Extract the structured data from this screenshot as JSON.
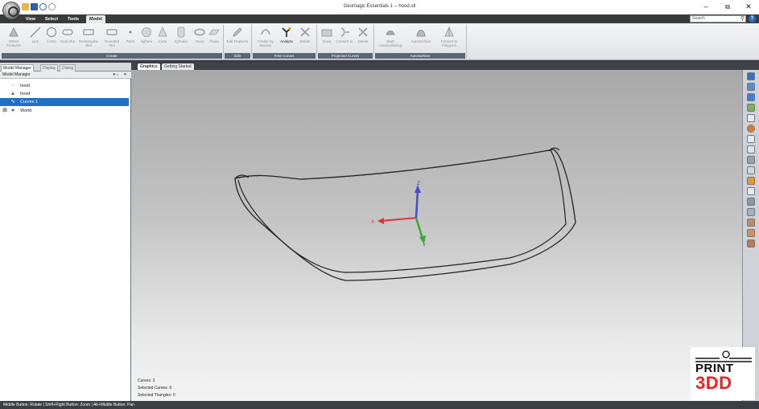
{
  "window": {
    "title": "Geomagic Essentials 1 -- hood.stl",
    "minimize_icon": "–",
    "restore_icon": "⧉",
    "close_icon": "✕"
  },
  "ribbon": {
    "tabs": [
      {
        "id": "view",
        "label": "View"
      },
      {
        "id": "select",
        "label": "Select"
      },
      {
        "id": "tools",
        "label": "Tools"
      },
      {
        "id": "model",
        "label": "Model",
        "active": true
      }
    ],
    "search_placeholder": "Search",
    "help_label": "?",
    "groups": [
      {
        "label": "Create"
      },
      {
        "label": "Edit"
      },
      {
        "label": "Free Curves"
      },
      {
        "label": "Projected Curves"
      },
      {
        "label": "AutoSurface"
      }
    ],
    "buttons": {
      "detect_features": "Detect Features",
      "line": "Line",
      "circle": "Circle",
      "oval_slot": "Oval Slot",
      "rectangular_slot": "Rectangular Slot",
      "rounded_slot": "Rounded Slot",
      "point": "Point",
      "sphere": "Sphere",
      "cone": "Cone",
      "cylinder": "Cylinder",
      "torus": "Torus",
      "plane": "Plane",
      "edit_features": "Edit Features",
      "create_by_section": "Create by Section",
      "analyze": "Analyze",
      "delete_free": "Delete",
      "draw": "Draw",
      "convert_to": "Convert to",
      "delete_projected": "Delete",
      "start_autosurfacing": "Start AutoSurfacing",
      "autosurface": "AutoSurface",
      "convert_to_polygons": "Convert to Polygons"
    }
  },
  "left_panel": {
    "tabs": [
      {
        "id": "model-manager",
        "label": "Model Manager",
        "active": true
      },
      {
        "id": "display",
        "label": "Display"
      },
      {
        "id": "dialog",
        "label": "Dialog"
      }
    ],
    "header": {
      "title": "Model Manager",
      "pin": "▾ ⌂",
      "close": "✕"
    },
    "tree": [
      {
        "label": "hood",
        "icon": "point-cloud-icon",
        "glyph": "⁘"
      },
      {
        "label": "hood",
        "icon": "mesh-icon",
        "glyph": "▲"
      },
      {
        "label": "Curves 1",
        "icon": "curves-icon",
        "glyph": "∿",
        "selected": true
      },
      {
        "label": "World",
        "icon": "globe-icon",
        "glyph": "●",
        "expander": "⊞"
      }
    ]
  },
  "viewport": {
    "doc_tabs": [
      {
        "label": "Graphics",
        "active": true
      },
      {
        "label": "Getting Started"
      }
    ],
    "axes": {
      "x": "X",
      "y": "Y",
      "z": "Z"
    },
    "stats": [
      "Curves: 3",
      "Selected Curves: 0",
      "Selected Triangles: 0"
    ]
  },
  "statusbar": {
    "text": "Middle Button: Rotate | Shift+Right Button: Zoom | Alt+Middle Button: Pan"
  },
  "watermark": {
    "line1": "PRINT",
    "line2": "3DD"
  }
}
